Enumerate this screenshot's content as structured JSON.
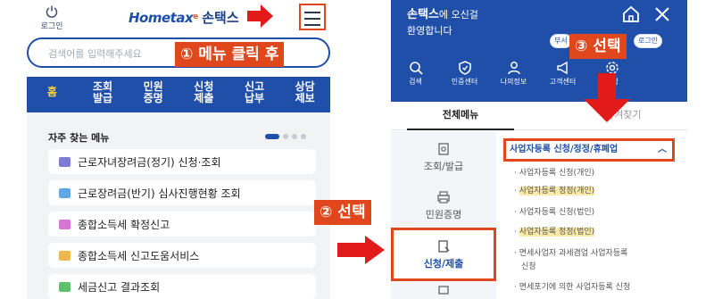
{
  "left": {
    "login_label": "로그인",
    "logo_text": "Hometax",
    "logo_e": "e",
    "logo_son": "손택스",
    "search_placeholder": "검색어를 입력해주세요",
    "nav": [
      {
        "l1": "홈",
        "l2": ""
      },
      {
        "l1": "조회",
        "l2": "발급"
      },
      {
        "l1": "민원",
        "l2": "증명"
      },
      {
        "l1": "신청",
        "l2": "제출"
      },
      {
        "l1": "신고",
        "l2": "납부"
      },
      {
        "l1": "상담",
        "l2": "제보"
      }
    ],
    "freq_title": "자주 찾는 메뉴",
    "items": [
      {
        "label": "근로자녀장려금(정기) 신청·조회",
        "color": "#7e7bd6"
      },
      {
        "label": "근로장려금(반기) 심사진행현황 조회",
        "color": "#5fa8e8"
      },
      {
        "label": "종합소득세 확정신고",
        "color": "#d775d6"
      },
      {
        "label": "종합소득세 신고도움서비스",
        "color": "#f0b84a"
      },
      {
        "label": "세금신고 결과조회",
        "color": "#5fc06b"
      }
    ]
  },
  "callouts": {
    "step1": "① 메뉴 클릭 후",
    "step2": "② 선택",
    "step3": "③ 선택"
  },
  "right": {
    "welcome_name": "손택스",
    "welcome_suffix": "에 오신걸",
    "welcome_line2": "환영합니다",
    "chip1": "부서",
    "chip2": "로그인",
    "quick": [
      "검색",
      "인증센터",
      "나의정보",
      "고객센터",
      "설정"
    ],
    "tab_all": "전체메뉴",
    "tab_2": "즐겨찾기",
    "side": [
      {
        "label": "조회/발급"
      },
      {
        "label": "민원증명"
      },
      {
        "label": "신청/제출"
      }
    ],
    "sub_head": "사업자등록 신청/정정/휴폐업",
    "sub_items": [
      "사업자등록 신청(개인)",
      "사업자등록 정정(개인)",
      "사업자등록 신청(법인)",
      "사업자등록 정정(법인)",
      "면세사업자 과세겸업 사업자등록",
      "신청",
      "면세포기에 의한 사업자등록 신청"
    ]
  },
  "colors": {
    "brand": "#1f4fa8",
    "accent": "#e0471d",
    "arrow": "#e21a1a",
    "highlight": "#fbe9a6"
  }
}
